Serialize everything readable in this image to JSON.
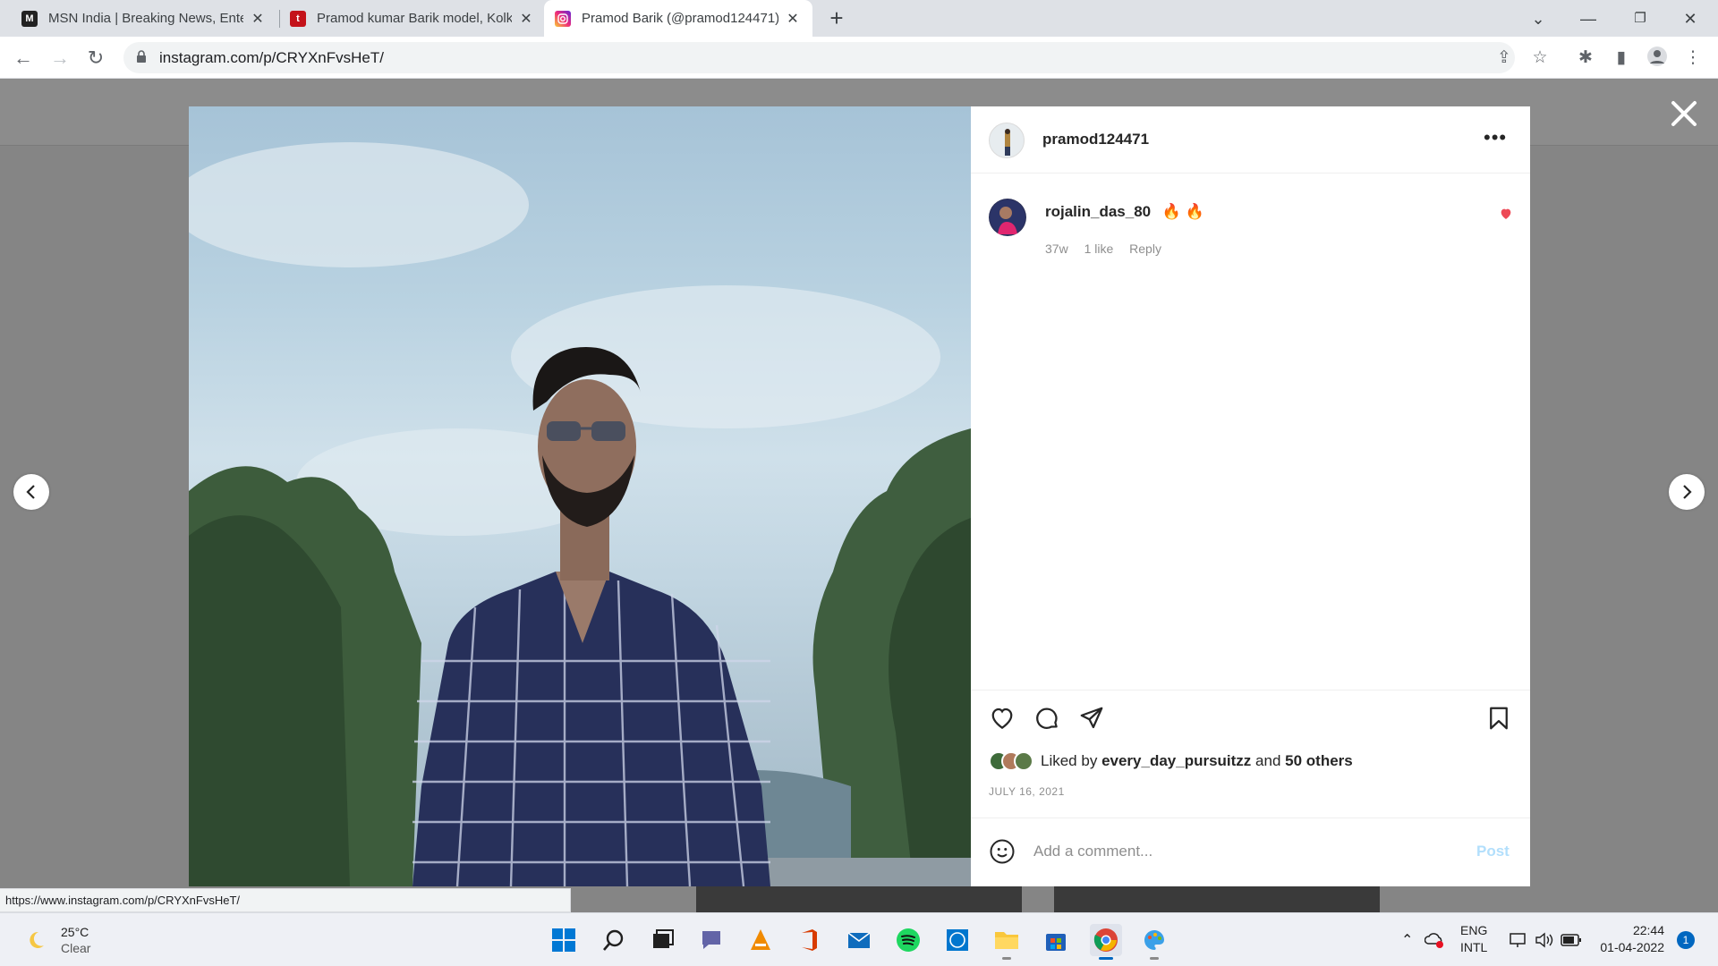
{
  "browser": {
    "tabs": [
      {
        "title": "MSN India | Breaking News, Entertainment",
        "favicon": "msn-icon",
        "active": false
      },
      {
        "title": "Pramod kumar Barik model, Kolkata",
        "favicon": "t-icon",
        "active": false
      },
      {
        "title": "Pramod Barik (@pramod124471)",
        "favicon": "instagram-icon",
        "active": true
      }
    ],
    "url": "instagram.com/p/CRYXnFvsHeT/",
    "status_url": "https://www.instagram.com/p/CRYXnFvsHeT/"
  },
  "post": {
    "author": "pramod124471",
    "more_label": "•••",
    "comment": {
      "user": "rojalin_das_80",
      "text": "🔥 🔥",
      "age": "37w",
      "likes": "1 like",
      "reply": "Reply"
    },
    "liked_by_prefix": "Liked by",
    "liked_by_user": "every_day_pursuitzz",
    "liked_by_and": "and",
    "liked_by_others": "50 others",
    "date": "JULY 16, 2021",
    "comment_placeholder": "Add a comment...",
    "post_button": "Post"
  },
  "taskbar": {
    "temperature": "25°C",
    "weather": "Clear",
    "lang_top": "ENG",
    "lang_bottom": "INTL",
    "time": "22:44",
    "date": "01-04-2022",
    "notifications": "1"
  },
  "colors": {
    "heart_red": "#ed4956",
    "post_disabled": "#b2dffc",
    "overlay": "#858585"
  }
}
